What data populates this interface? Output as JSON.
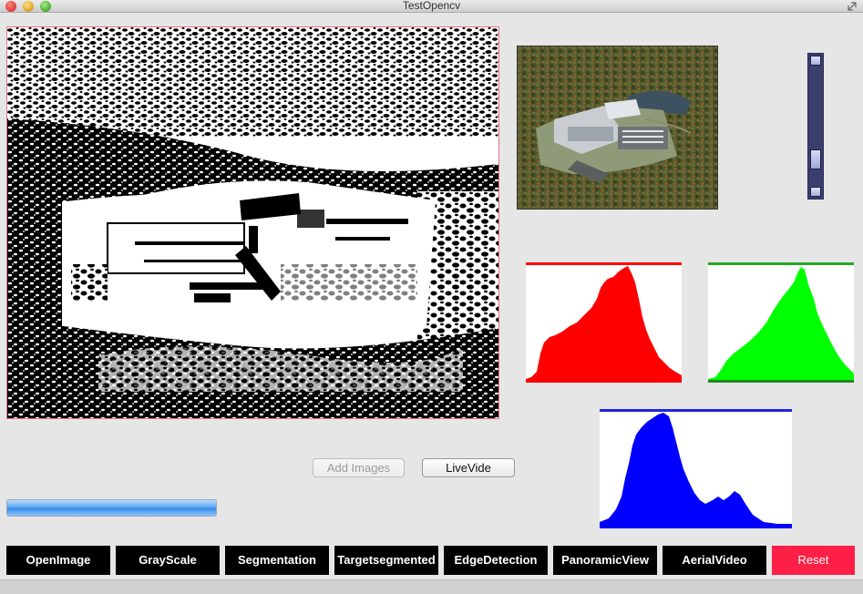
{
  "window": {
    "title": "TestOpencv"
  },
  "controls": {
    "add_images_label": "Add Images",
    "live_video_label": "LiveVide",
    "progress": 1.0
  },
  "toolbar": {
    "buttons": [
      {
        "label": "OpenImage"
      },
      {
        "label": "GrayScale"
      },
      {
        "label": "Segmentation"
      },
      {
        "label": "Targetsegmented"
      },
      {
        "label": "EdgeDetection"
      },
      {
        "label": "PanoramicView"
      },
      {
        "label": "AerialVideo"
      },
      {
        "label": "Reset"
      }
    ]
  },
  "histograms": {
    "red": {
      "color": "#ff0000"
    },
    "green": {
      "color": "#00ff00"
    },
    "blue": {
      "color": "#0000ff"
    }
  },
  "colors": {
    "reset_button": "#fd1f45",
    "image_border": "#e8738c",
    "scrollbar": "#3b3f6e"
  },
  "icons": [
    "resize-icon",
    "close-button",
    "minimize-button",
    "zoom-button"
  ]
}
